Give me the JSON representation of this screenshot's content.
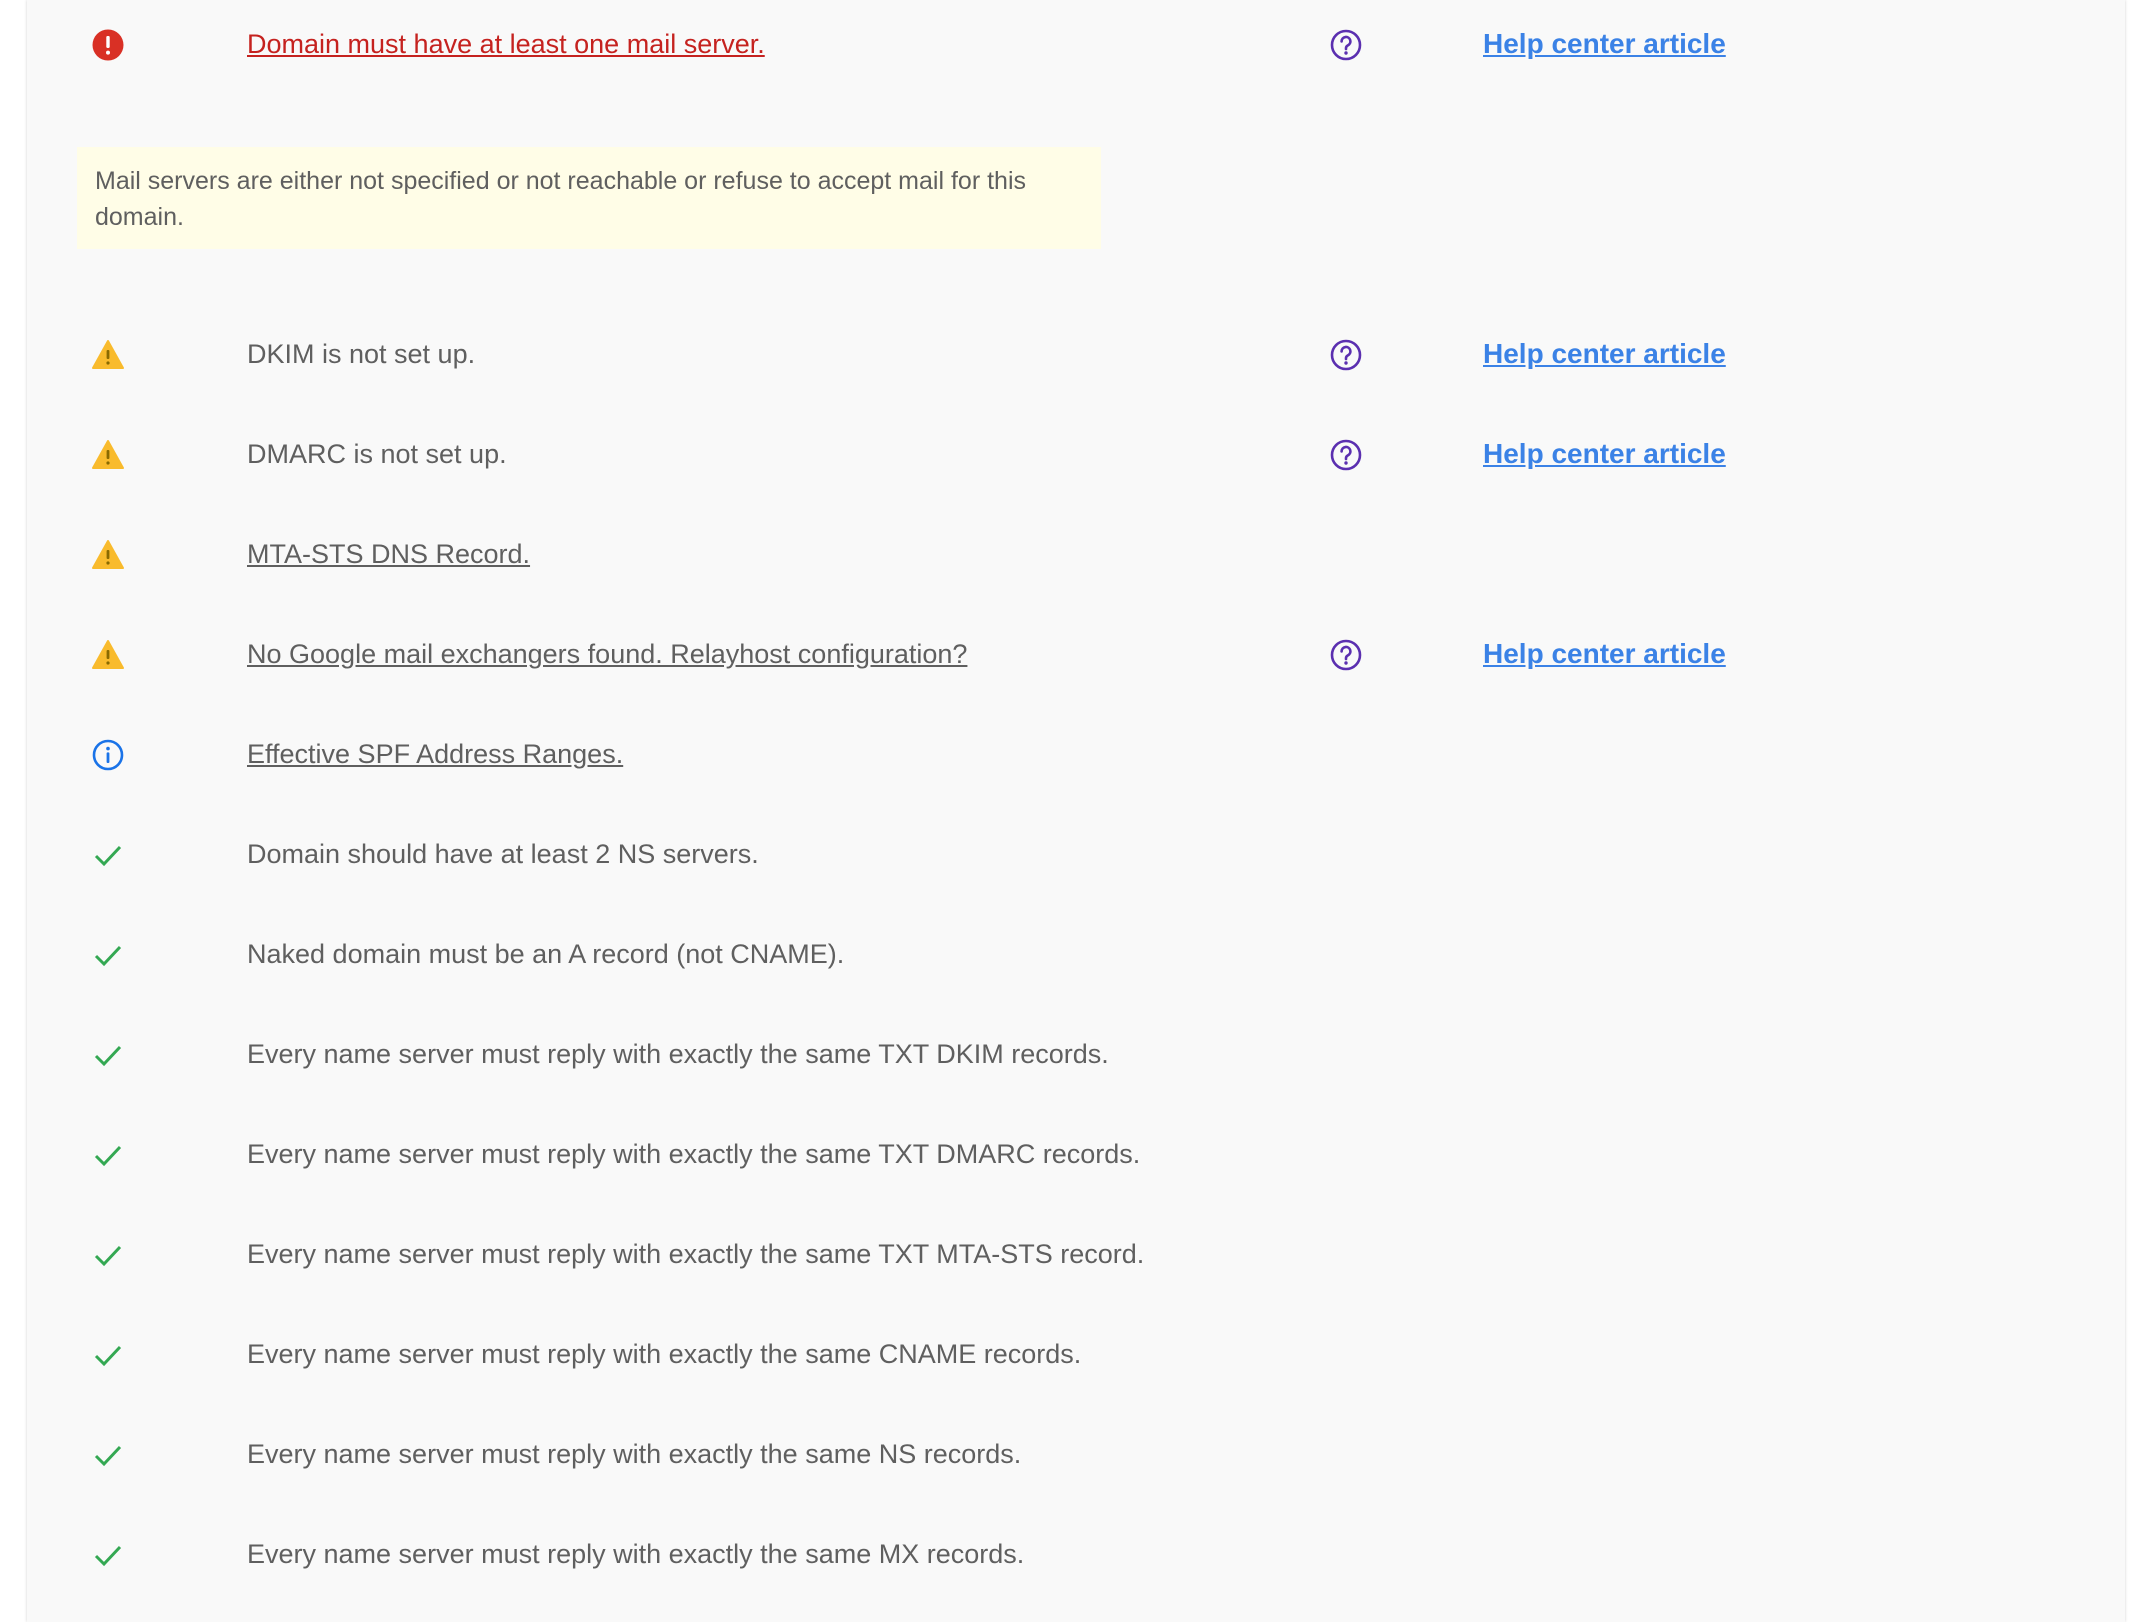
{
  "colors": {
    "error": "#d93025",
    "warning": "#f9bb2d",
    "info": "#1a73e8",
    "success": "#34a853",
    "help": "#5b2fb0",
    "link": "#3b82e6",
    "note_background": "#fffde7"
  },
  "rows": [
    {
      "status": "error",
      "icon": "error-icon",
      "text": "Domain must have at least one mail server.",
      "help_link": "Help center article"
    },
    {
      "status": "warning",
      "icon": "warning-icon",
      "text": "DKIM is not set up.",
      "help_link": "Help center article"
    },
    {
      "status": "warning",
      "icon": "warning-icon",
      "text": "DMARC is not set up.",
      "help_link": "Help center article"
    },
    {
      "status": "warning",
      "icon": "warning-icon",
      "text": "MTA-STS DNS Record."
    },
    {
      "status": "warning",
      "icon": "warning-icon",
      "text": "No Google mail exchangers found. Relayhost configuration?",
      "help_link": "Help center article"
    },
    {
      "status": "info",
      "icon": "info-icon",
      "text": "Effective SPF Address Ranges."
    },
    {
      "status": "success",
      "icon": "check-icon",
      "text": "Domain should have at least 2 NS servers."
    },
    {
      "status": "success",
      "icon": "check-icon",
      "text": "Naked domain must be an A record (not CNAME)."
    },
    {
      "status": "success",
      "icon": "check-icon",
      "text": "Every name server must reply with exactly the same TXT DKIM records."
    },
    {
      "status": "success",
      "icon": "check-icon",
      "text": "Every name server must reply with exactly the same TXT DMARC records."
    },
    {
      "status": "success",
      "icon": "check-icon",
      "text": "Every name server must reply with exactly the same TXT MTA-STS record."
    },
    {
      "status": "success",
      "icon": "check-icon",
      "text": "Every name server must reply with exactly the same CNAME records."
    },
    {
      "status": "success",
      "icon": "check-icon",
      "text": "Every name server must reply with exactly the same NS records."
    },
    {
      "status": "success",
      "icon": "check-icon",
      "text": "Every name server must reply with exactly the same MX records."
    }
  ],
  "error_note": "Mail servers are either not specified or not reachable or refuse to accept mail for this domain.",
  "help_icon": "help-circle-icon"
}
